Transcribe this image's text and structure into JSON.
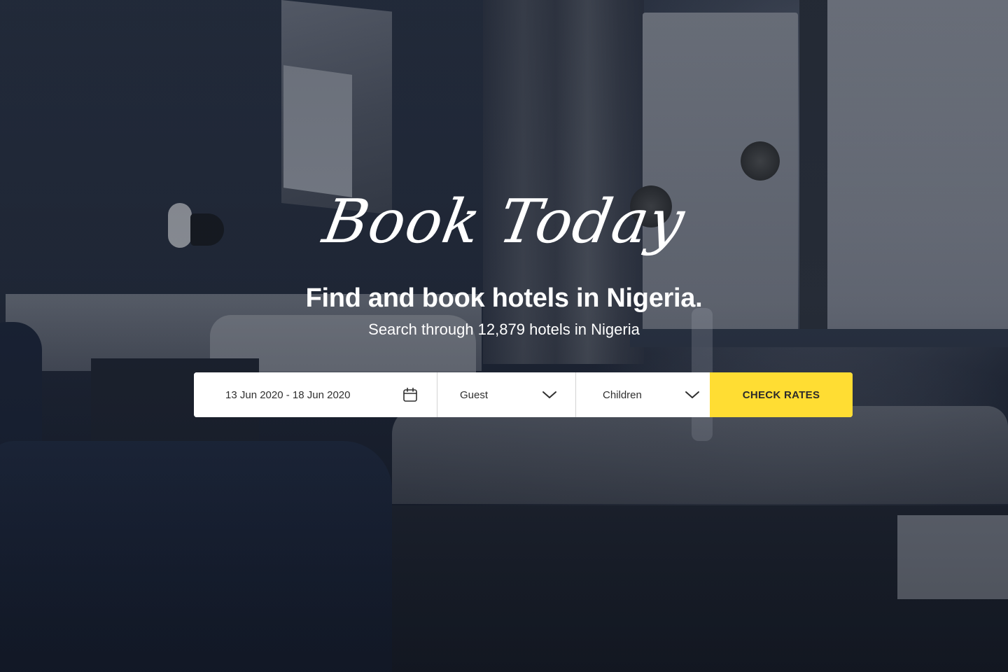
{
  "hero": {
    "script_title": "Book Today",
    "headline": "Find and book hotels in Nigeria.",
    "subheadline": "Search through 12,879 hotels in Nigeria"
  },
  "search": {
    "date_range": "13 Jun 2020 - 18 Jun 2020",
    "date_icon": "calendar-icon",
    "guest_label": "Guest",
    "guest_icon": "chevron-down-icon",
    "children_label": "Children",
    "children_icon": "chevron-down-icon",
    "submit_label": "CHECK RATES"
  },
  "colors": {
    "accent": "#ffdd33",
    "text_light": "#ffffff",
    "field_text": "#2f2f2f",
    "button_text": "#2b2b2b"
  }
}
